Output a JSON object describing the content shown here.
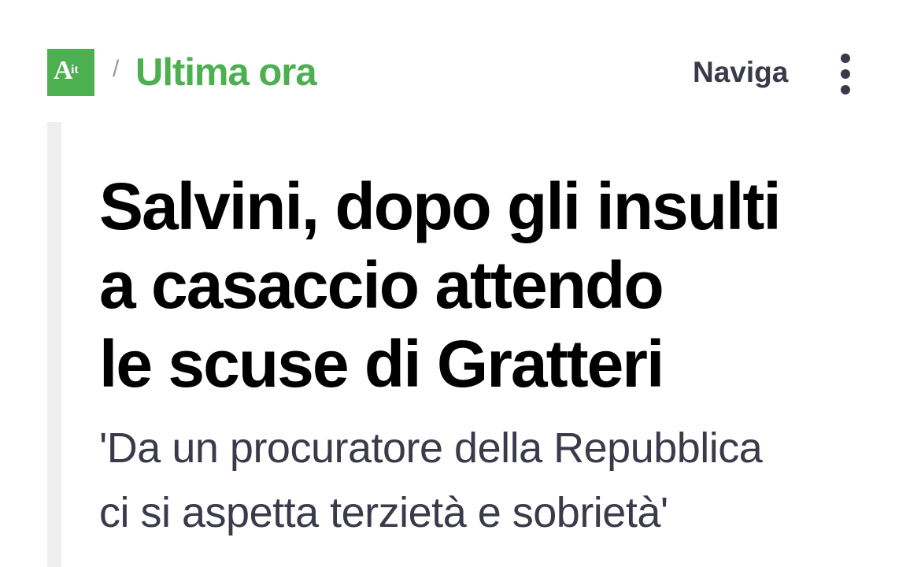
{
  "header": {
    "logo": {
      "letter": "A",
      "suffix": "it",
      "color": "#4caf50"
    },
    "breadcrumb_separator": "/",
    "section_title": "Ultima ora",
    "nav_label": "Naviga",
    "more_icon": "vertical-ellipsis-icon"
  },
  "article": {
    "headline_lines": [
      "Salvini, dopo gli insulti",
      "a casaccio attendo",
      "le scuse di Gratteri"
    ],
    "subtitle_lines": [
      "'Da un procuratore della Repubblica",
      "ci si aspetta terzietà e sobrietà'"
    ]
  },
  "colors": {
    "accent": "#4caf50",
    "text_dark": "#000000",
    "text_muted": "#3a3a4a"
  }
}
